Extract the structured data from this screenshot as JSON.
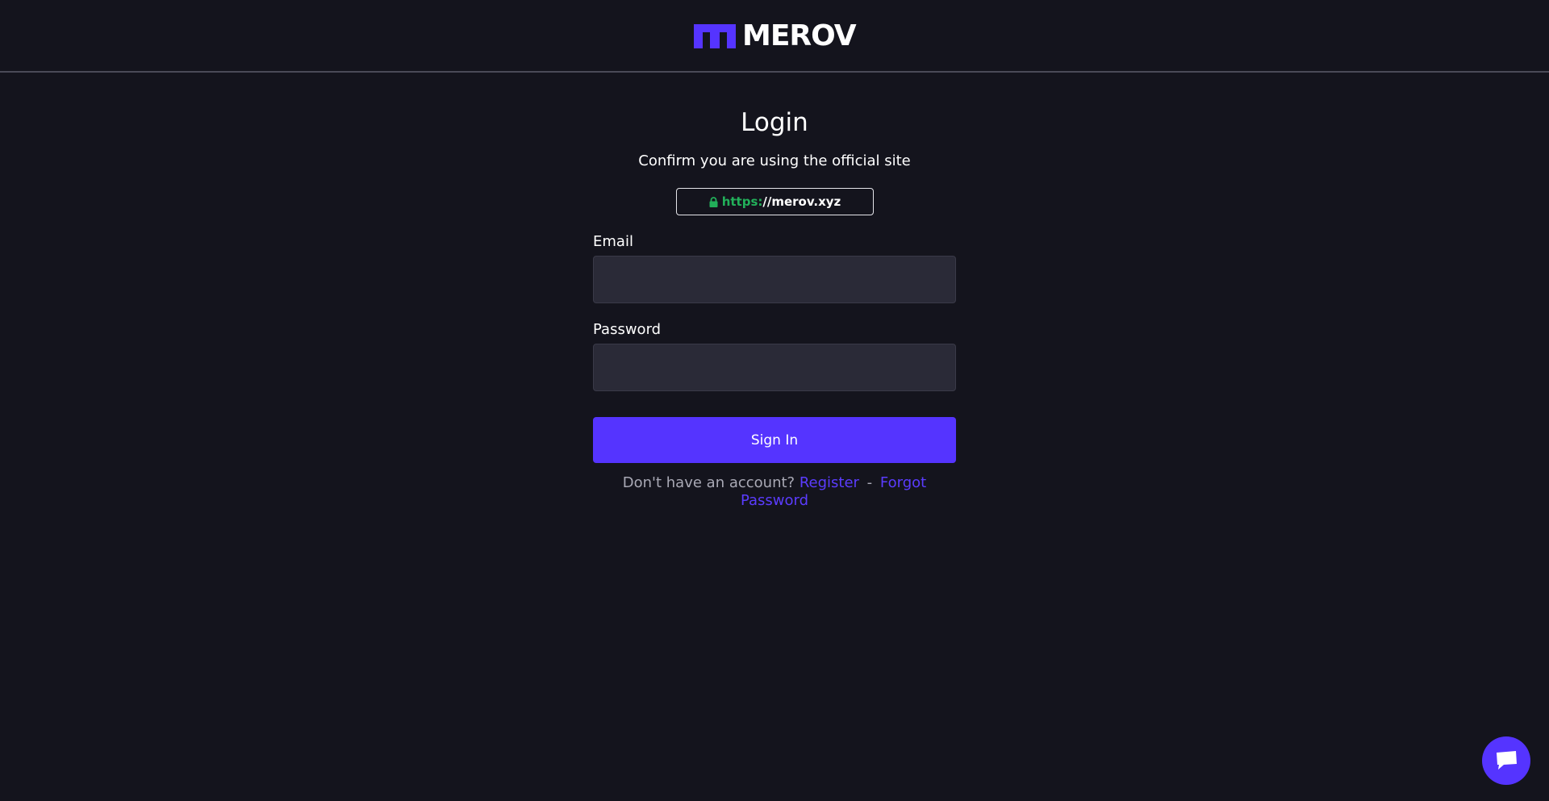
{
  "header": {
    "logo_text": "MEROV",
    "logo_icon": "merov-m-logo-icon",
    "brand_color": "#5534ff"
  },
  "login": {
    "title": "Login",
    "subtitle": "Confirm you are using the official site",
    "url_scheme": "https:",
    "url_host": "//merov.xyz",
    "lock_icon": "lock-icon",
    "email_label": "Email",
    "email_value": "",
    "password_label": "Password",
    "password_value": "",
    "signin_label": "Sign In",
    "no_account_text": "Don't have an account?",
    "register_label": "Register",
    "separator": "-",
    "forgot_label": "Forgot Password"
  },
  "chat": {
    "icon": "chat-bubble-icon"
  },
  "colors": {
    "background": "#14141d",
    "input_bg": "#2a2a37",
    "accent": "#5534ff",
    "secure_green": "#22b05a",
    "muted_text": "#a9a9b5"
  }
}
